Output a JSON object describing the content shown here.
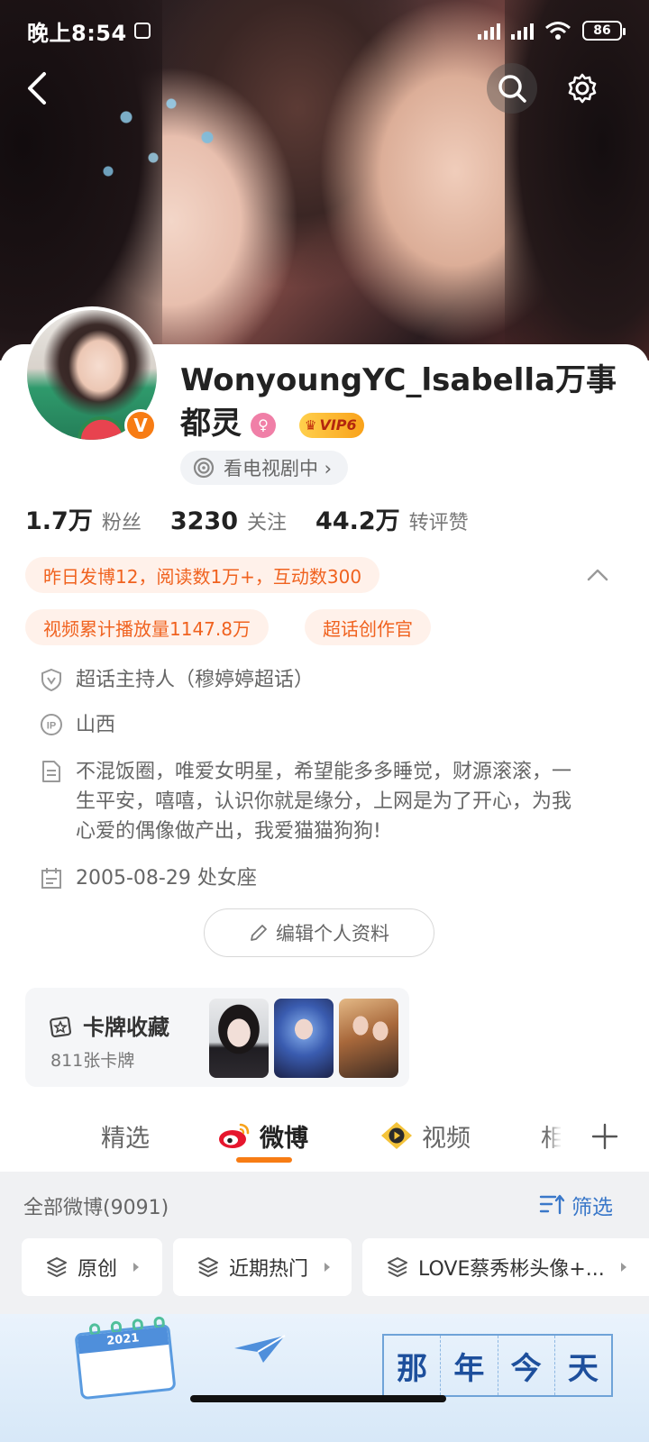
{
  "status_bar": {
    "time": "晚上8:54",
    "battery": "86"
  },
  "nav": {
    "back_icon": "back-arrow-icon",
    "search_icon": "search-icon",
    "settings_icon": "gear-icon"
  },
  "profile": {
    "name": "WonyoungYC_lsabella万事都灵",
    "vip_label": "VIP6",
    "verified_mark": "V",
    "status_text": "看电视剧中 ›",
    "stats": [
      {
        "num": "1.7万",
        "label": "粉丝"
      },
      {
        "num": "3230",
        "label": "关注"
      },
      {
        "num": "44.2万",
        "label": "转评赞"
      }
    ],
    "chips": {
      "daily": "昨日发博12，阅读数1万+，互动数300",
      "video": "视频累计播放量1147.8万",
      "creator": "超话创作官"
    },
    "info": {
      "host": "超话主持人（穆婷婷超话）",
      "ip": "山西",
      "bio": "不混饭圈，唯爱女明星，希望能多多睡觉，财源滚滚，一生平安，嘻嘻，认识你就是缘分，上网是为了开心，为我心爱的偶像做产出，我爱猫猫狗狗!",
      "birthday": "2005-08-29 处女座"
    },
    "edit_label": "编辑个人资料"
  },
  "cards": {
    "title": "卡牌收藏",
    "count": "811张卡牌"
  },
  "tabs": {
    "featured": "精选",
    "weibo": "微博",
    "video": "视频",
    "partial": "相"
  },
  "feed": {
    "count_label": "全部微博(9091)",
    "filter_label": "筛选",
    "filters": [
      "原创",
      "近期热门",
      "LOVE蔡秀彬头像+..."
    ]
  },
  "banner": {
    "chars": [
      "那",
      "年",
      "今",
      "天"
    ],
    "calendar_year": "2021"
  },
  "colors": {
    "accent": "#f77c14",
    "chip_text": "#f0621f",
    "chip_bg": "#fff1ea",
    "link": "#3a78c9"
  }
}
